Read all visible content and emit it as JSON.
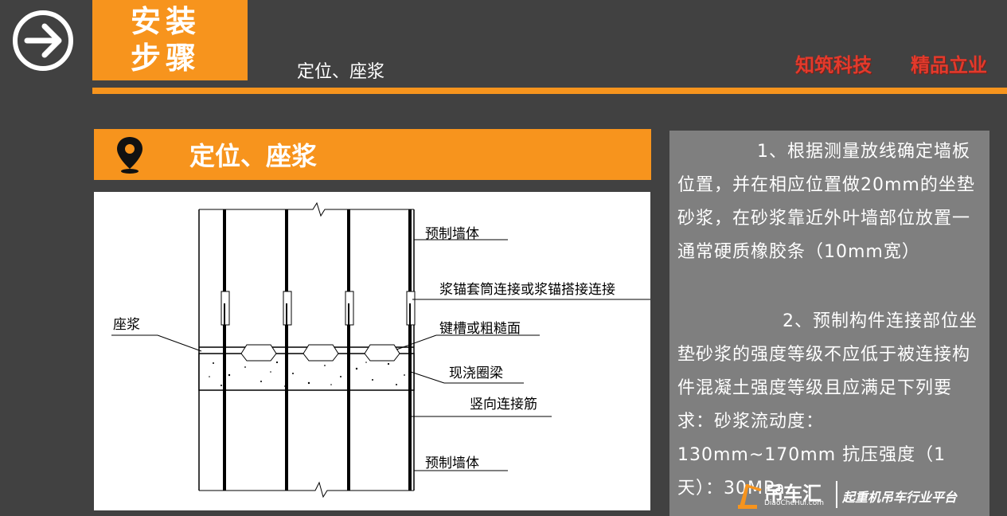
{
  "header": {
    "title_line1": "安装",
    "title_line2": "步骤",
    "subtitle": "定位、座浆",
    "brand_left": "知筑科技",
    "brand_right": "精品立业"
  },
  "section": {
    "title": "定位、座浆"
  },
  "diagram": {
    "labels": {
      "precast_wall_top": "预制墙体",
      "sleeve": "浆锚套筒连接或浆锚搭接连接",
      "bed_mortar": "座浆",
      "shear_key": "键槽或粗糙面",
      "ring_beam": "现浇圈梁",
      "vertical_bar": "竖向连接筋",
      "precast_wall_bottom": "预制墙体"
    }
  },
  "description": {
    "para1": "1、根据测量放线确定墙板位置，并在相应位置做20mm的坐垫砂浆，在砂浆靠近外叶墙部位放置一通常硬质橡胶条（10mm宽）",
    "para2": "2、预制构件连接部位坐垫砂浆的强度等级不应低于被连接构件混凝土强度等级且应满足下列要求：砂浆流动度：130mm~170mm 抗压强度（1天）：30MPa"
  },
  "watermark": {
    "name": "吊车汇",
    "url": "DiaoCheHui.com",
    "slogan": "起重机吊车行业平台"
  },
  "colors": {
    "background": "#414141",
    "accent": "#F7941D",
    "panel": "#7F7F7F",
    "brand": "#E23A2C"
  },
  "icons": [
    "arrow-right-circle-icon",
    "location-pin-icon",
    "crane-logo-icon"
  ]
}
